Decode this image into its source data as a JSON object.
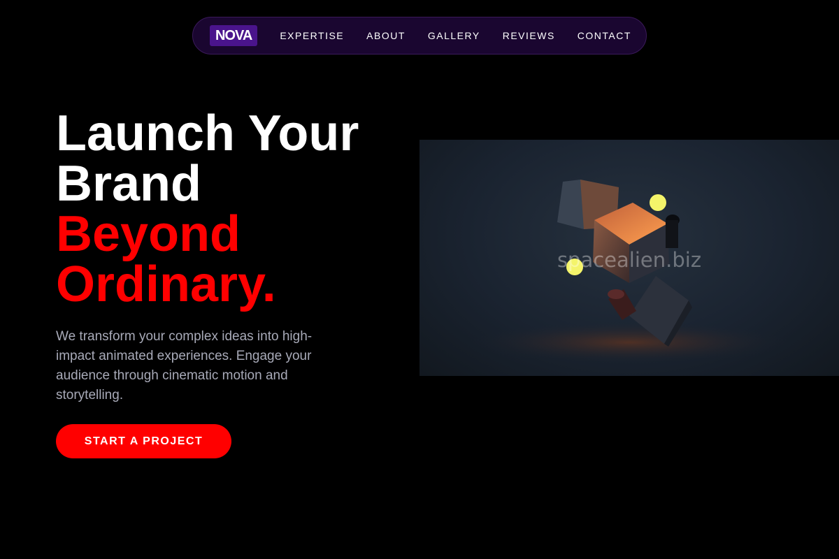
{
  "nav": {
    "logo": "NOVA",
    "links": [
      "EXPERTISE",
      "ABOUT",
      "GALLERY",
      "REVIEWS",
      "CONTACT"
    ]
  },
  "hero": {
    "title_line1": "Launch Your",
    "title_line2": "Brand",
    "title_accent_line1": "Beyond",
    "title_accent_line2": "Ordinary.",
    "description": "We transform your complex ideas into high-impact animated experiences. Engage your audience through cinematic motion and storytelling.",
    "cta_label": "START A PROJECT",
    "image_watermark": "spacealien.biz"
  },
  "colors": {
    "background": "#000000",
    "accent": "#ff0000",
    "nav_bg": "#1a0630",
    "logo_bg": "#4a148c"
  }
}
